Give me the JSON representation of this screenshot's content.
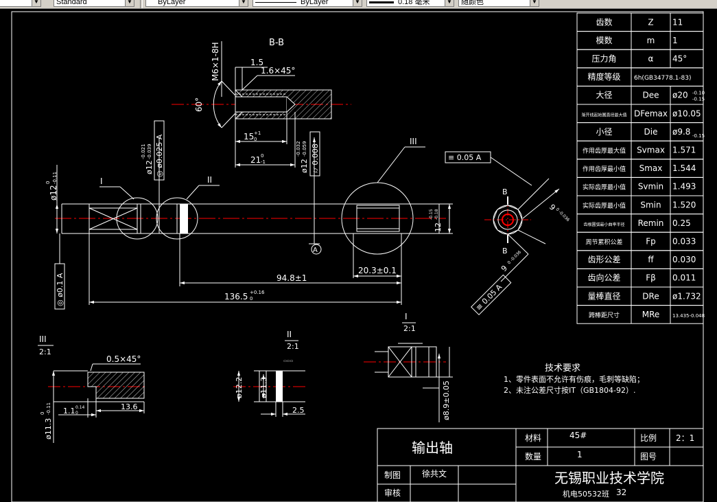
{
  "toolbar": {
    "text_style": "Standard",
    "layer": "ByLayer",
    "linetype": "ByLayer",
    "lineweight": "0.18 毫米",
    "plot_style": "随颜色"
  },
  "views": {
    "section_bb": "B-B",
    "thread_note": "M6×1-8H",
    "chamfer_1_5": "1.5",
    "chamfer_note": "1.6×45°",
    "angle_60": "60°",
    "depth_15_base": "15",
    "depth_15_tol": "+1",
    "depth_15_low": "0",
    "depth_21_base": "21",
    "depth_21_tol_up": "0",
    "depth_21_tol_low": "-1",
    "dia12_left": "ø12",
    "dia12_left_tol_up": "-0.021",
    "dia12_left_tol_low": "-0.039",
    "tol_frame_left": "◎ ø0.025 A",
    "dia12_right": "ø12",
    "dia12_right_tol_up": "-0.032",
    "dia12_right_tol_low": "-0.059",
    "tol_frame_right": "⌭ 0.008",
    "dia12_main": "ø12",
    "dia12_main_tol_up": "0",
    "dia12_main_tol_low": "-0.11",
    "label_I": "I",
    "label_II": "II",
    "label_III": "III",
    "datum_A": "A",
    "dim_12_right": "12",
    "dim_12_right_tol_up": "-0.15",
    "dim_12_right_tol_low": "-0.18",
    "dim_20_3": "20.3±0.1",
    "dim_94_8": "94.8±1",
    "dim_136_5": "136.5",
    "dim_136_5_tol_up": "+0.16",
    "dim_136_5_tol_low": "0",
    "tol_frame_bottom_left": "◎ ø0.1 A",
    "tol_frame_top_right": "≡ 0.05 A",
    "tol_frame_bottom_right": "≡ 0.05 A",
    "label_B": "B",
    "dim_9_upper": "9",
    "dim_9_upper_tol": "0 -0.036",
    "dim_9_lower": "9",
    "dim_9_lower_tol": "0 -0.036",
    "detail_III_label": "III",
    "detail_III_scale": "2:1",
    "detail_III_chamfer": "0.5×45°",
    "detail_III_dia": "ø11.3",
    "detail_III_dia_tol_up": "0",
    "detail_III_dia_tol_low": "-0.11",
    "detail_III_1_1": "1.1",
    "detail_III_1_1_tol_up": "0.14",
    "detail_III_1_1_tol_low": "0",
    "detail_III_13_6": "13.6",
    "detail_II_label": "II",
    "detail_II_scale": "2:1",
    "detail_II_dia12": "ø12.2",
    "detail_II_dia11": "ø11.3",
    "detail_II_2_5": "2.5",
    "detail_I_label": "I",
    "detail_I_scale": "2:1",
    "detail_I_dia": "ø8.9±0.05"
  },
  "gear_table": [
    {
      "name": "齿数",
      "symbol": "Z",
      "value": "11"
    },
    {
      "name": "模数",
      "symbol": "m",
      "value": "1"
    },
    {
      "name": "压力角",
      "symbol": "α",
      "value": "45°"
    },
    {
      "name": "精度等级",
      "symbol": "6h(GB34778.1-83)",
      "value": ""
    },
    {
      "name": "大径",
      "symbol": "Dee",
      "value": "ø20",
      "tol_up": "-0.10",
      "tol_low": "-0.15"
    },
    {
      "name": "渐开线起始圆直径最大值",
      "symbol": "DFemax",
      "value": "ø10.05"
    },
    {
      "name": "小径",
      "symbol": "Die",
      "value": "ø9.8",
      "tol_low": "-0.15"
    },
    {
      "name": "作用齿厚最大值",
      "symbol": "Svmax",
      "value": "1.571"
    },
    {
      "name": "作用齿厚最小值",
      "symbol": "Smax",
      "value": "1.544"
    },
    {
      "name": "实际齿厚最小值",
      "symbol": "Svmin",
      "value": "1.493"
    },
    {
      "name": "实际齿厚最小值",
      "symbol": "Smin",
      "value": "1.520"
    },
    {
      "name": "齿根圆弧最小曲率半径",
      "symbol": "Remin",
      "value": "0.25"
    },
    {
      "name": "周节累积公差",
      "symbol": "Fp",
      "value": "0.033"
    },
    {
      "name": "齿形公差",
      "symbol": "ff",
      "value": "0.030"
    },
    {
      "name": "齿向公差",
      "symbol": "Fβ",
      "value": "0.011"
    },
    {
      "name": "量棒直径",
      "symbol": "DRe",
      "value": "ø1.732"
    },
    {
      "name": "跨棒距尺寸",
      "symbol": "MRe",
      "value": "13.435-0.048"
    }
  ],
  "tech_requirements": {
    "title": "技术要求",
    "line1": "1、零件表面不允许有伤痕，毛刺等缺陷；",
    "line2": "2、未注公差尺寸按IT（GB1804-92）."
  },
  "title_block": {
    "part_name": "输出轴",
    "material_label": "材料",
    "material_value": "45#",
    "scale_label": "比例",
    "scale_value": "2：1",
    "quantity_label": "数量",
    "quantity_value": "1",
    "drawing_no_label": "图号",
    "drawn_label": "制图",
    "drawn_name": "徐共文",
    "checked_label": "审核",
    "school": "无锡职业技术学院",
    "class_info": "机电50532班",
    "student_no": "32"
  },
  "colors": {
    "background": "#000000",
    "lines": "#ffffff",
    "centerline": "#ff0000",
    "toolbar": "#d4d0c8"
  }
}
